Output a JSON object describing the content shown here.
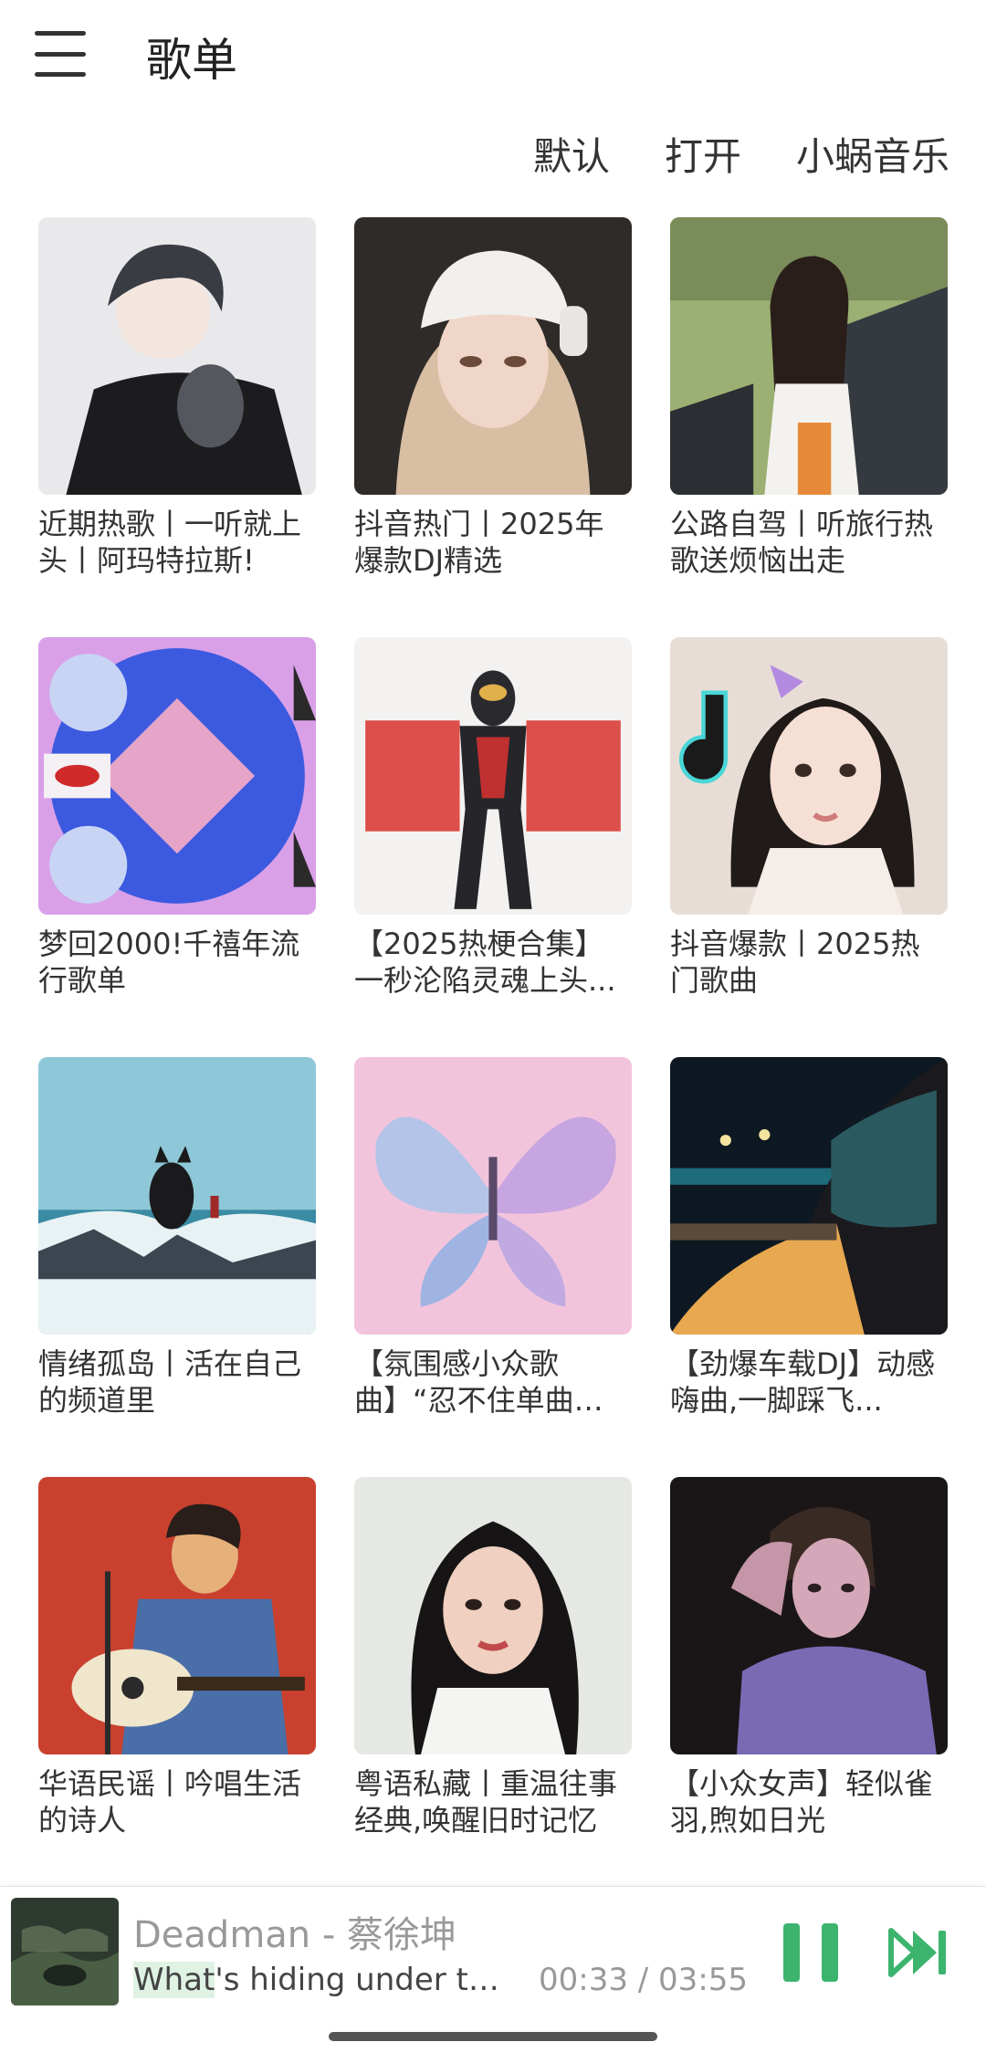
{
  "header": {
    "title": "歌单"
  },
  "actions": [
    {
      "label": "默认"
    },
    {
      "label": "打开"
    },
    {
      "label": "小蜗音乐"
    }
  ],
  "playlists": [
    {
      "title": "近期热歌丨一听就上头丨阿玛特拉斯!",
      "icon": "anime-boy-cat-cover"
    },
    {
      "title": "抖音热门丨2025年爆款DJ精选",
      "icon": "girl-headphones-cover"
    },
    {
      "title": "公路自驾丨听旅行热歌送烦恼出走",
      "icon": "roadtrip-girl-cover"
    },
    {
      "title": "梦回2000!千禧年流行歌单",
      "icon": "y2k-cd-cover"
    },
    {
      "title": "【2025热梗合集】一秒沦陷灵魂上头...",
      "icon": "ultraman-cover"
    },
    {
      "title": "抖音爆款丨2025热门歌曲",
      "icon": "tiktok-girl-cover"
    },
    {
      "title": "情绪孤岛丨活在自己的频道里",
      "icon": "cat-on-rock-cover"
    },
    {
      "title": "【氛围感小众歌曲】“忍不住单曲循环!”",
      "icon": "butterfly-cover"
    },
    {
      "title": "【劲爆车载DJ】动感嗨曲,一脚踩飞...",
      "icon": "night-car-cover"
    },
    {
      "title": "华语民谣丨吟唱生活的诗人",
      "icon": "guitarist-cover"
    },
    {
      "title": "粤语私藏丨重温往事经典,唤醒旧时记忆",
      "icon": "retro-woman-cover"
    },
    {
      "title": "【小众女声】轻似雀羽,煦如日光",
      "icon": "dark-girl-cover"
    }
  ],
  "player": {
    "song": "Deadman - 蔡徐坤",
    "lyric_highlight": "What",
    "lyric_rest": "'s hiding under that bl...",
    "time": "00:33 / 03:55",
    "progress": 0.14,
    "accent_color": "#3cb46e"
  }
}
